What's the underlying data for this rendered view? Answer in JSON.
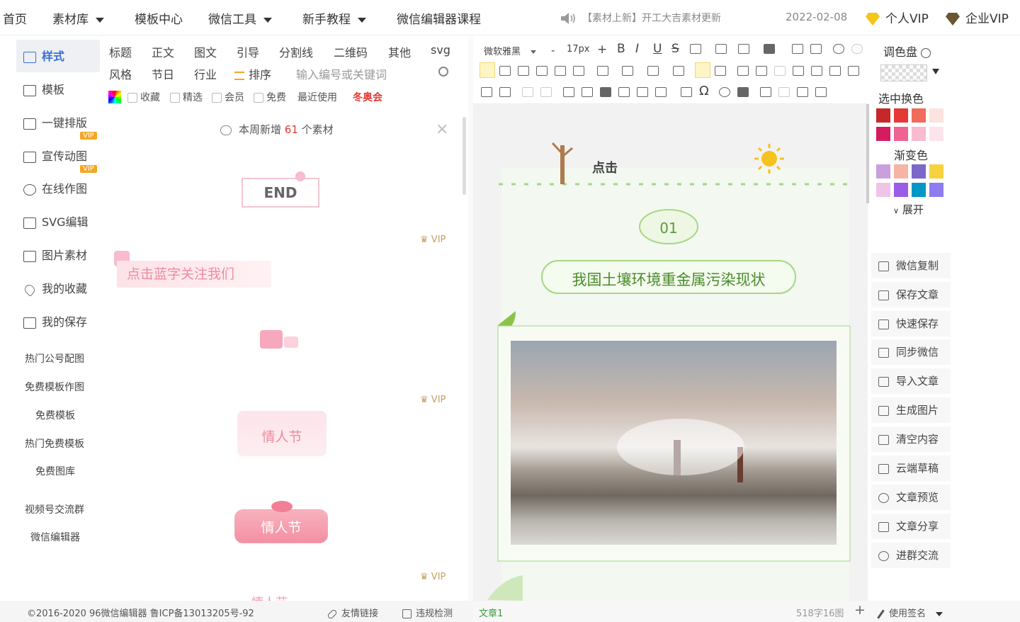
{
  "nav": {
    "items": [
      "首页",
      "素材库",
      "模板中心",
      "微信工具",
      "新手教程",
      "微信编辑器课程"
    ],
    "notice": "【素材上新】开工大吉素材更新",
    "date": "2022-02-08",
    "personal_vip": "个人VIP",
    "enterprise_vip": "企业VIP"
  },
  "sidebar": {
    "items": [
      "样式",
      "模板",
      "一键排版",
      "宣传动图",
      "在线作图",
      "SVG编辑",
      "图片素材",
      "我的收藏",
      "我的保存"
    ],
    "vip_badge": "VIP",
    "links": [
      "热门公号配图",
      "免费模板作图",
      "免费模板",
      "热门免费模板",
      "免费图库",
      "视频号交流群",
      "微信编辑器"
    ]
  },
  "materials": {
    "row1": [
      "标题",
      "正文",
      "图文",
      "引导",
      "分割线",
      "二维码",
      "其他",
      "svg"
    ],
    "row2": [
      "风格",
      "节日",
      "行业"
    ],
    "sort": "排序",
    "search_placeholder": "输入编号或关键词",
    "filters": [
      "收藏",
      "精选",
      "会员",
      "免费"
    ],
    "recent": "最近使用",
    "winter": "冬奥会",
    "weekly_prefix": "本周新增",
    "weekly_count": "61",
    "weekly_suffix": "个素材",
    "vip_label": "VIP",
    "samples": {
      "end": "END",
      "follow": "点击蓝字关注我们",
      "valentine1": "情人节",
      "valentine2": "情人节",
      "partial": "情人节"
    }
  },
  "editor": {
    "font": "微软雅黑",
    "font_size": "17px",
    "minus": "-",
    "plus": "+",
    "buttons": [
      "B",
      "I",
      "U",
      "S"
    ],
    "symbols": [
      "Ω"
    ],
    "article": {
      "click_text": "点击",
      "number": "01",
      "title": "我国土壤环境重金属污染现状"
    }
  },
  "palette": {
    "title": "调色盘",
    "select_change": "选中换色",
    "gradient": "渐变色",
    "expand": "展开",
    "solid_colors": [
      "#c62828",
      "#e53935",
      "#ef6c5a",
      "#fbe3df",
      "#d81b60",
      "#f06292",
      "#f8bbd0",
      "#fce4ec"
    ],
    "gradient_colors": [
      "#c9a0dc",
      "#f6b5a4",
      "#7b68c9",
      "#f7d23e",
      "#f0c4e8",
      "#9b5de5",
      "#0096c7",
      "#8e7cf0"
    ]
  },
  "actions": [
    "微信复制",
    "保存文章",
    "快速保存",
    "同步微信",
    "导入文章",
    "生成图片",
    "清空内容",
    "云端草稿",
    "文章预览",
    "文章分享",
    "进群交流"
  ],
  "footer": {
    "copyright": "©2016-2020 96微信编辑器 鲁ICP备13013205号-92",
    "friend_links": "友情链接",
    "check": "违规检测",
    "tab": "文章1",
    "count": "518字16图",
    "signature": "使用签名"
  }
}
